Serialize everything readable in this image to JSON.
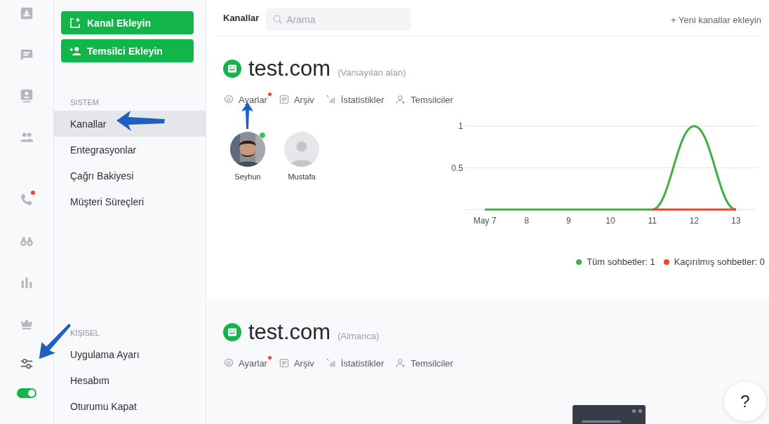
{
  "rail": {
    "items": [
      {
        "selected": false,
        "badge": false
      },
      {
        "selected": false,
        "badge": false
      },
      {
        "selected": false,
        "badge": false
      },
      {
        "selected": false,
        "badge": false
      },
      {
        "selected": false,
        "badge": true
      },
      {
        "selected": false,
        "badge": false
      },
      {
        "selected": false,
        "badge": false
      },
      {
        "selected": false,
        "badge": false
      },
      {
        "selected": true,
        "badge": false
      }
    ],
    "status_switch": {
      "on": true
    }
  },
  "menu": {
    "buttons": [
      {
        "kind": "channel",
        "label": "Kanal Ekleyin"
      },
      {
        "kind": "agent",
        "label": "Temsilci Ekleyin"
      }
    ],
    "sections": [
      {
        "heading": "SISTEM",
        "items": [
          {
            "label": "Kanallar",
            "selected": true
          },
          {
            "label": "Entegrasyonlar",
            "selected": false
          },
          {
            "label": "Çağrı Bakiyesi",
            "selected": false
          },
          {
            "label": "Müşteri Süreçleri",
            "selected": false
          }
        ]
      },
      {
        "heading": "KIŞISEL",
        "items": [
          {
            "label": "Uygulama Ayarı",
            "selected": false
          },
          {
            "label": "Hesabım",
            "selected": false
          },
          {
            "label": "Oturumu Kapat",
            "selected": false
          }
        ]
      }
    ]
  },
  "header": {
    "title": "Kanallar",
    "search": {
      "placeholder": "Arama"
    },
    "add_link": "+ Yeni kanallar ekleyin"
  },
  "channels": [
    {
      "name": "test.com",
      "note": "(Varsayılan alan)",
      "actions": [
        {
          "kind": "settings",
          "label": "Ayarlar",
          "badge": true
        },
        {
          "kind": "archive",
          "label": "Arşiv",
          "badge": false
        },
        {
          "kind": "stats",
          "label": "İstatistikler",
          "badge": false
        },
        {
          "kind": "agents",
          "label": "Temsilciler",
          "badge": false
        }
      ],
      "agents": [
        {
          "name": "Seyhun",
          "kind": "picture",
          "online": true
        },
        {
          "name": "Mustafa",
          "kind": "placeholder",
          "online": false
        }
      ],
      "chart_data": {
        "type": "line",
        "categories": [
          "May 7",
          "8",
          "9",
          "10",
          "11",
          "12",
          "13"
        ],
        "ylim": [
          0,
          1
        ],
        "yticks": [
          0.5,
          1
        ],
        "series": [
          {
            "color": "#3cb043",
            "values": [
              0,
              0,
              0,
              0,
              0,
              1,
              0
            ]
          },
          {
            "color": "#f4421e",
            "values": [
              null,
              null,
              null,
              null,
              0,
              0,
              0
            ]
          }
        ]
      },
      "legend": [
        "Tüm sohbetler: 1",
        "Kaçırılmış sohbetler: 0"
      ]
    },
    {
      "name": "test.com",
      "note": "(Almanca)",
      "actions": [
        {
          "kind": "settings",
          "label": "Ayarlar",
          "badge": true
        },
        {
          "kind": "archive",
          "label": "Arşiv",
          "badge": false
        },
        {
          "kind": "stats",
          "label": "İstatistikler",
          "badge": false
        },
        {
          "kind": "agents",
          "label": "Temsilciler",
          "badge": false
        }
      ]
    }
  ],
  "help_button": {
    "label": "?"
  }
}
